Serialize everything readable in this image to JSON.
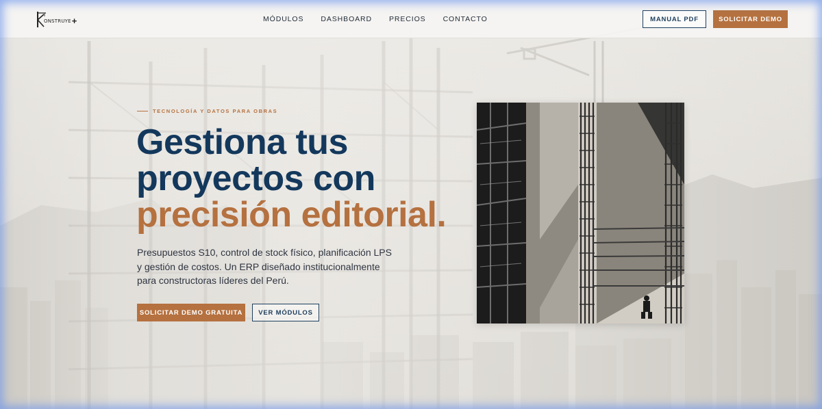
{
  "brand": {
    "logo_text": "ONSTRUYE",
    "logo_letter": "K"
  },
  "nav": {
    "items": [
      "MÓDULOS",
      "DASHBOARD",
      "PRECIOS",
      "CONTACTO"
    ]
  },
  "header_actions": {
    "manual_label": "MANUAL PDF",
    "demo_label": "SOLICITAR DEMO"
  },
  "hero": {
    "eyebrow": "TECNOLOGÍA Y DATOS PARA OBRAS",
    "headline_line1": "Gestiona tus",
    "headline_line2": "proyectos con",
    "headline_accent": "precisión editorial.",
    "lead": "Presupuestos S10, control de stock físico, planificación LPS y gestión de costos. Un ERP diseñado institucionalmente para constructoras líderes del Perú.",
    "cta_primary": "SOLICITAR DEMO GRATUITA",
    "cta_secondary": "VER MÓDULOS"
  },
  "colors": {
    "navy": "#13385c",
    "copper": "#b5713f",
    "header_bg": "#f5f4f2"
  },
  "icons": {
    "logo": "crane-hook-logo-icon",
    "plus": "plus-icon"
  }
}
